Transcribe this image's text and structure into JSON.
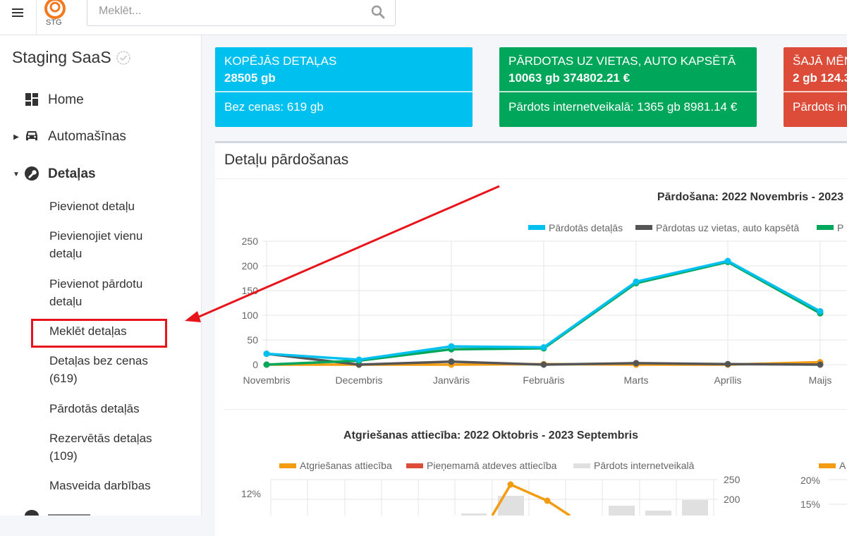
{
  "app": {
    "logo_text": "STG",
    "search": {
      "placeholder": "Meklēt..."
    }
  },
  "sidebar": {
    "brand": "Staging SaaS",
    "items": [
      {
        "label": "Home",
        "icon": "dashboard-icon"
      },
      {
        "label": "Automašīnas",
        "icon": "car-icon"
      },
      {
        "label": "Detaļas",
        "icon": "wrench-icon"
      }
    ],
    "sub_items": [
      {
        "label": "Pievienot detaļu"
      },
      {
        "label": "Pievienojiet vienu detaļu"
      },
      {
        "label": "Pievienot pārdotu detaļu"
      },
      {
        "label": "Meklēt detaļas"
      },
      {
        "label": "Detaļas bez cenas (619)"
      },
      {
        "label": "Pārdotās detaļās"
      },
      {
        "label": "Rezervētās detaļas (109)"
      },
      {
        "label": "Masveida darbības"
      }
    ]
  },
  "infoboxes": [
    {
      "title": "KOPĒJĀS DETAĻAS",
      "value": "28505 gb",
      "footer": "Bez cenas: 619 gb",
      "color": "#00c0ef"
    },
    {
      "title": "PĀRDOTAS UZ VIETAS, AUTO KAPSĒTĀ",
      "value": "10063 gb 374802.21 €",
      "footer": "Pārdots internetveikalā: 1365 gb 8981.14 €",
      "color": "#00a65a"
    },
    {
      "title": "ŠAJĀ MĒN",
      "value": "2 gb 124.3",
      "footer": "Pārdots in",
      "color": "#dd4b39"
    }
  ],
  "panel": {
    "title": "Detaļu pārdošanas"
  },
  "chart_data": [
    {
      "type": "line",
      "title": "Pārdošana: 2022 Novembris - 2023",
      "categories": [
        "Novembris",
        "Decembris",
        "Janvāris",
        "Februāris",
        "Marts",
        "Aprīlis",
        "Maijs"
      ],
      "ylim": [
        0,
        250
      ],
      "yticks": [
        0,
        50,
        100,
        150,
        200,
        250
      ],
      "grid": true,
      "legend_position": "top",
      "series": [
        {
          "name": "Pārdotās detaļās",
          "color": "#00c0ef",
          "values": [
            22,
            10,
            37,
            35,
            168,
            210,
            108
          ]
        },
        {
          "name": "Pārdotas uz vietas, auto kapsētā",
          "color": "#555555",
          "values": [
            22,
            0,
            6,
            0,
            3,
            1,
            0
          ]
        },
        {
          "name": "P",
          "color": "#00a65a",
          "values": [
            0,
            8,
            31,
            33,
            165,
            208,
            104
          ]
        },
        {
          "name": "",
          "color": "#f39c12",
          "values": [
            0,
            0,
            0,
            1,
            0,
            0,
            5
          ]
        }
      ]
    },
    {
      "type": "bar",
      "title": "Atgriešanas attiecība: 2022 Oktobris - 2023 Septembris",
      "legend_position": "top",
      "series": [
        {
          "name": "Atgriešanas attiecība",
          "color": "#f39c12"
        },
        {
          "name": "Pieņemamā atdeves attiecība",
          "color": "#dd4b39"
        },
        {
          "name": "Pārdots internetveikalā",
          "color": "#e0e0e0"
        }
      ],
      "left_axis_visible": [
        "12%"
      ],
      "right_axis_visible": [
        250,
        200
      ]
    },
    {
      "type": "line",
      "title": "",
      "legend": [
        "A"
      ],
      "left_axis_visible": [
        "20%",
        "15%"
      ]
    }
  ]
}
